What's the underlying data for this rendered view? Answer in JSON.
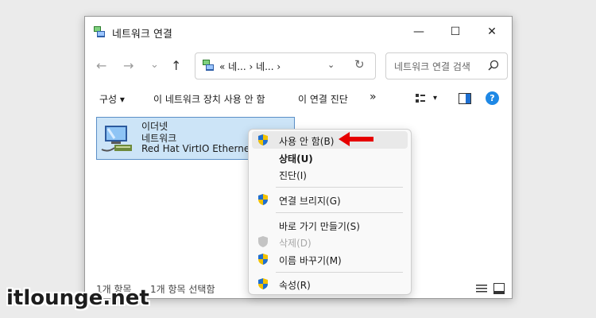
{
  "window": {
    "title": "네트워크 연결",
    "minimize_glyph": "—",
    "maximize_glyph": "☐",
    "close_glyph": "✕"
  },
  "nav": {
    "back_glyph": "←",
    "forward_glyph": "→",
    "recent_glyph": "⌄",
    "up_glyph": "↑"
  },
  "address": {
    "path": "« 네... › 네... ›",
    "dropdown_glyph": "⌄",
    "refresh_glyph": "↻"
  },
  "search": {
    "placeholder": "네트워크 연결 검색"
  },
  "commands": {
    "organize": "구성 ▾",
    "disable": "이 네트워크 장치 사용 안 함",
    "diagnose": "이 연결 진단",
    "more": "»",
    "view_glyph": "▾",
    "help_glyph": "?"
  },
  "item": {
    "name": "이더넷",
    "status": "네트워크",
    "device": "Red Hat VirtIO Ethernet A"
  },
  "status": {
    "count": "1개 항목",
    "selected": "1개 항목 선택함"
  },
  "context_menu": {
    "items": [
      {
        "label": "사용 안 함(B)",
        "icon": "shield-icon"
      },
      {
        "label": "상태(U)",
        "icon": "none"
      },
      {
        "label": "진단(I)",
        "icon": "none"
      },
      {
        "label": "연결 브리지(G)",
        "icon": "shield-icon"
      },
      {
        "label": "바로 가기 만들기(S)",
        "icon": "none"
      },
      {
        "label": "삭제(D)",
        "icon": "shield-gray-icon"
      },
      {
        "label": "이름 바꾸기(M)",
        "icon": "shield-icon"
      },
      {
        "label": "속성(R)",
        "icon": "shield-icon"
      }
    ]
  },
  "watermark": "itlounge.net",
  "colors": {
    "accent": "#0067c0",
    "selection": "#cce4f7",
    "arrow": "#e60000"
  }
}
